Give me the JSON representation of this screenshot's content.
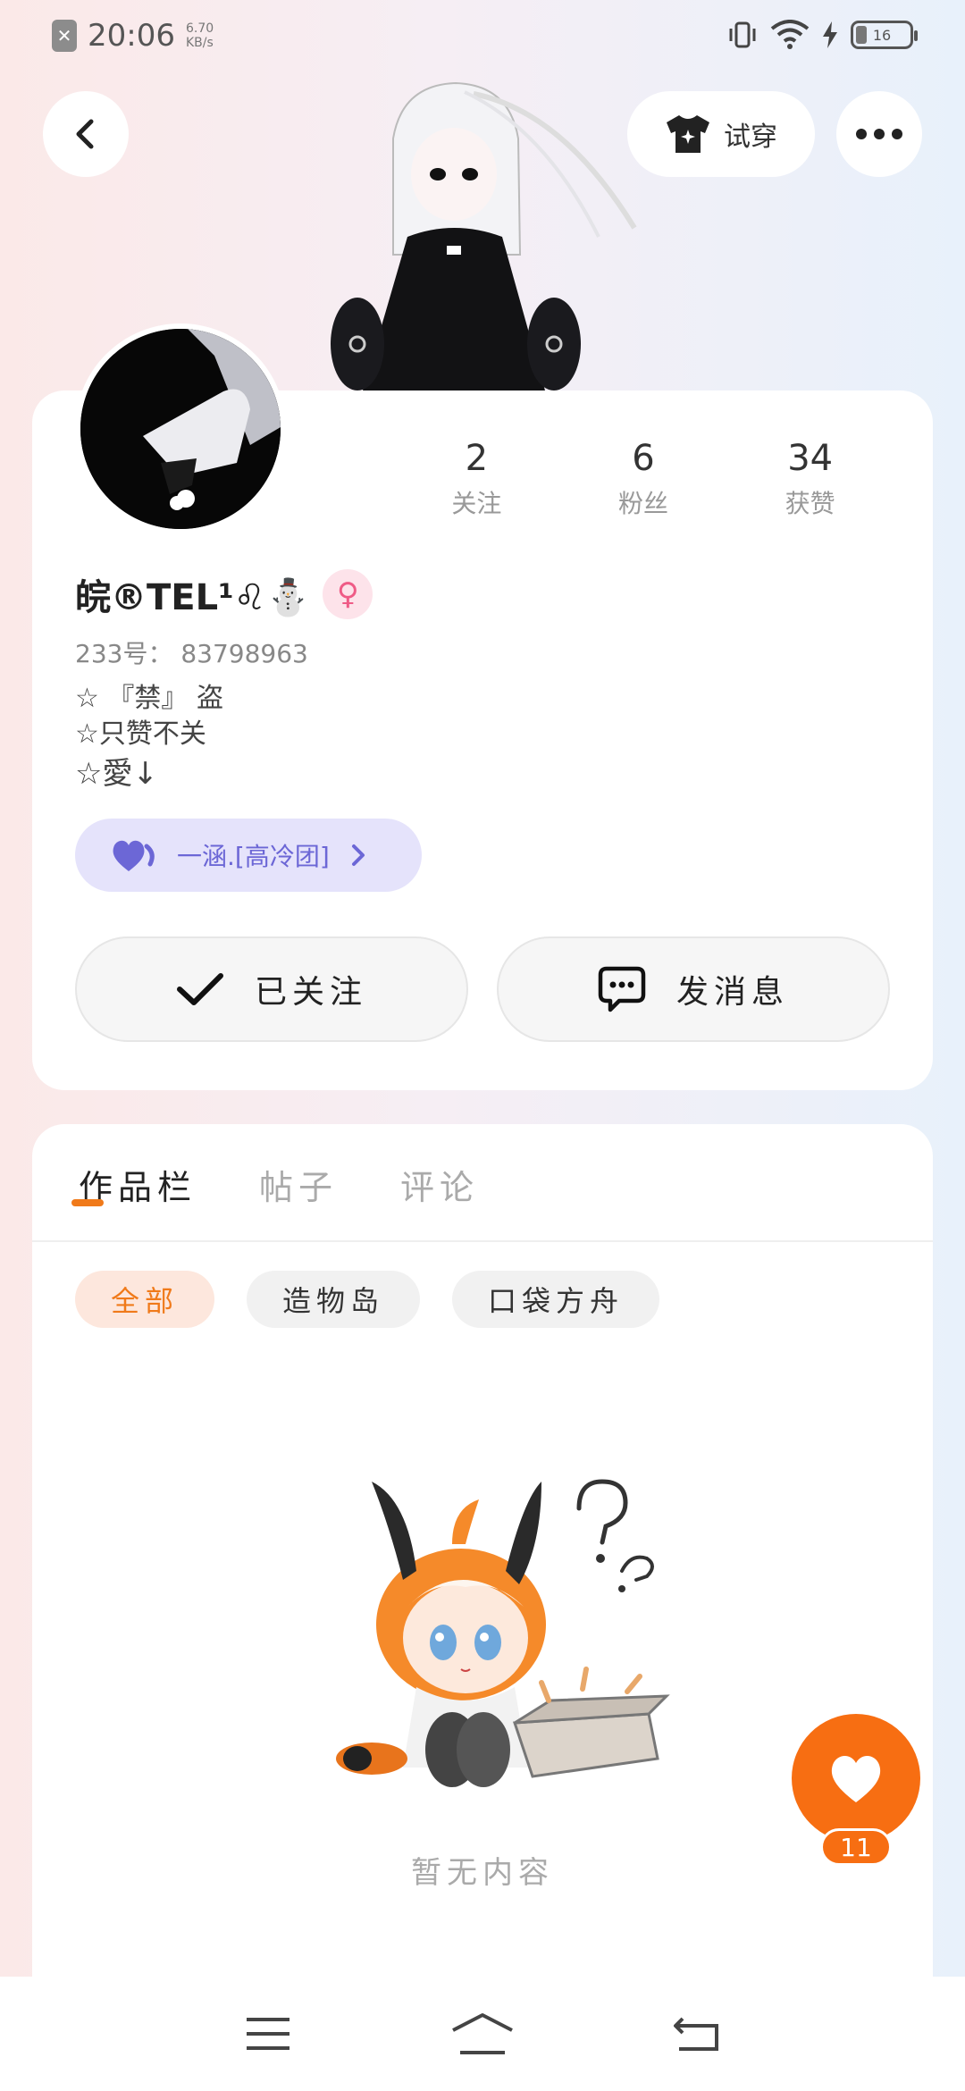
{
  "status_bar": {
    "time": "20:06",
    "speed_value": "6.70",
    "speed_unit": "KB/s",
    "battery": "16"
  },
  "header": {
    "try_on_label": "试穿",
    "icons": [
      "back-icon",
      "shirt-icon",
      "more-icon"
    ]
  },
  "profile": {
    "stats": [
      {
        "value": "2",
        "label": "关注"
      },
      {
        "value": "6",
        "label": "粉丝"
      },
      {
        "value": "34",
        "label": "获赞"
      }
    ],
    "nickname": "皖®TEL¹♌⛄",
    "gender_symbol": "♀",
    "uid": "233号： 83798963",
    "bio": [
      "☆ 『禁』 盗",
      "☆只赞不关",
      "☆愛↓"
    ],
    "group_label": "一涵.[高冷团]",
    "follow_label": "已关注",
    "message_label": "发消息"
  },
  "works": {
    "tabs": [
      "作品栏",
      "帖子",
      "评论"
    ],
    "active_tab": 0,
    "chips": [
      "全部",
      "造物岛",
      "口袋方舟"
    ],
    "active_chip": 0,
    "empty_text": "暂无内容"
  },
  "like_fab": {
    "count": "11",
    "color": "#f76e12"
  },
  "colors": {
    "accent": "#f07a1a",
    "group_purple": "#6c67d6"
  }
}
